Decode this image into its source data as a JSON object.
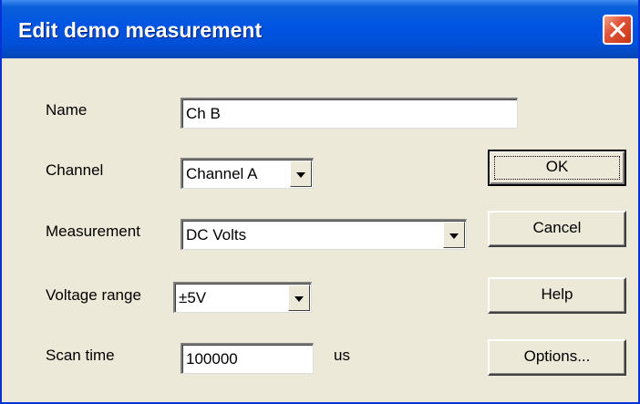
{
  "window": {
    "title": "Edit demo measurement"
  },
  "form": {
    "name": {
      "label": "Name",
      "value": "Ch B"
    },
    "channel": {
      "label": "Channel",
      "value": "Channel A"
    },
    "measurement": {
      "label": "Measurement",
      "value": "DC Volts"
    },
    "voltage_range": {
      "label": "Voltage range",
      "value": "±5V"
    },
    "scan_time": {
      "label": "Scan time",
      "value": "100000",
      "unit": "us"
    }
  },
  "buttons": {
    "ok": "OK",
    "cancel": "Cancel",
    "help": "Help",
    "options": "Options..."
  },
  "icons": {
    "close": "close-icon",
    "dropdown": "chevron-down-icon"
  },
  "colors": {
    "titlebar": "#0054e3",
    "close_button": "#e2553a",
    "dialog_background": "#ece9d8"
  }
}
